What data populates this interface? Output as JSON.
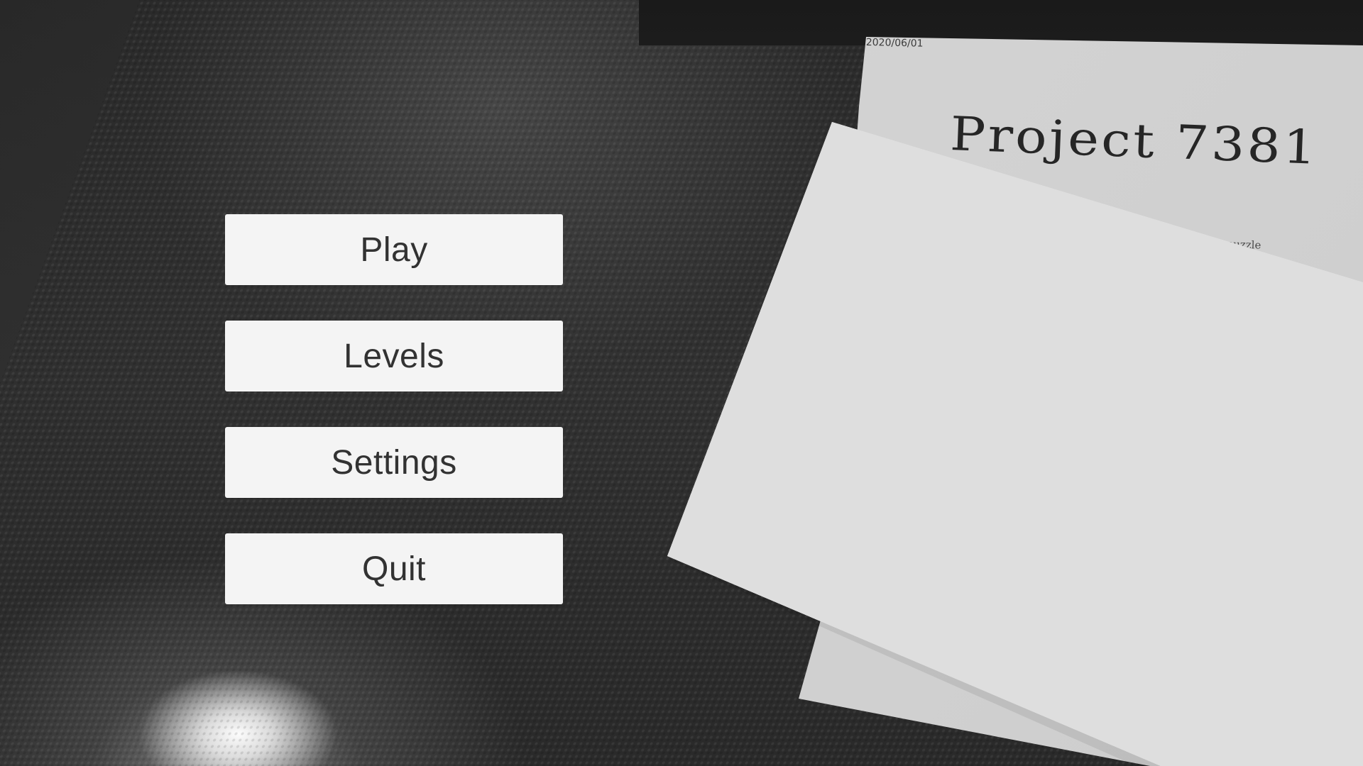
{
  "menu": {
    "play_label": "Play",
    "levels_label": "Levels",
    "settings_label": "Settings",
    "quit_label": "Quit"
  },
  "document": {
    "date": "2020/06/01",
    "title": "Project 7381",
    "tag": "puzzle"
  },
  "colors": {
    "button_background": "#f4f4f4",
    "button_text": "#323232",
    "paper_back": "#d1d1d1",
    "paper_front": "#dddddd",
    "background": "#2a2a2a"
  }
}
